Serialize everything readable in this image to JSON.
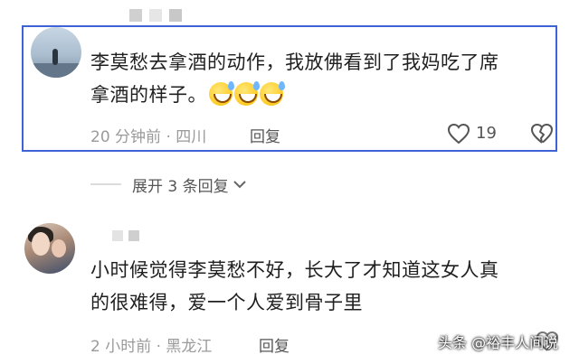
{
  "comment1": {
    "line1": "李莫愁去拿酒的动作，我放佛看到了我妈吃了席",
    "line2": "拿酒的样子。",
    "emojis": [
      "grinning-sweat-emoji",
      "grinning-sweat-emoji",
      "grinning-sweat-emoji"
    ],
    "meta": "20 分钟前 · 四川",
    "reply_label": "回复",
    "like_count": "19"
  },
  "expand": {
    "label": "展开 3 条回复"
  },
  "comment2": {
    "line1": "小时候觉得李莫愁不好，长大了才知道这女人真",
    "line2": "的很难得，爱一个人爱到骨子里",
    "meta": "2 小时前 · 黑龙江",
    "reply_label": "回复"
  },
  "watermark": "头条 @裕丰人间说",
  "colors": {
    "highlight_border": "#3d63d6",
    "meta_gray": "#9a9a9a"
  }
}
